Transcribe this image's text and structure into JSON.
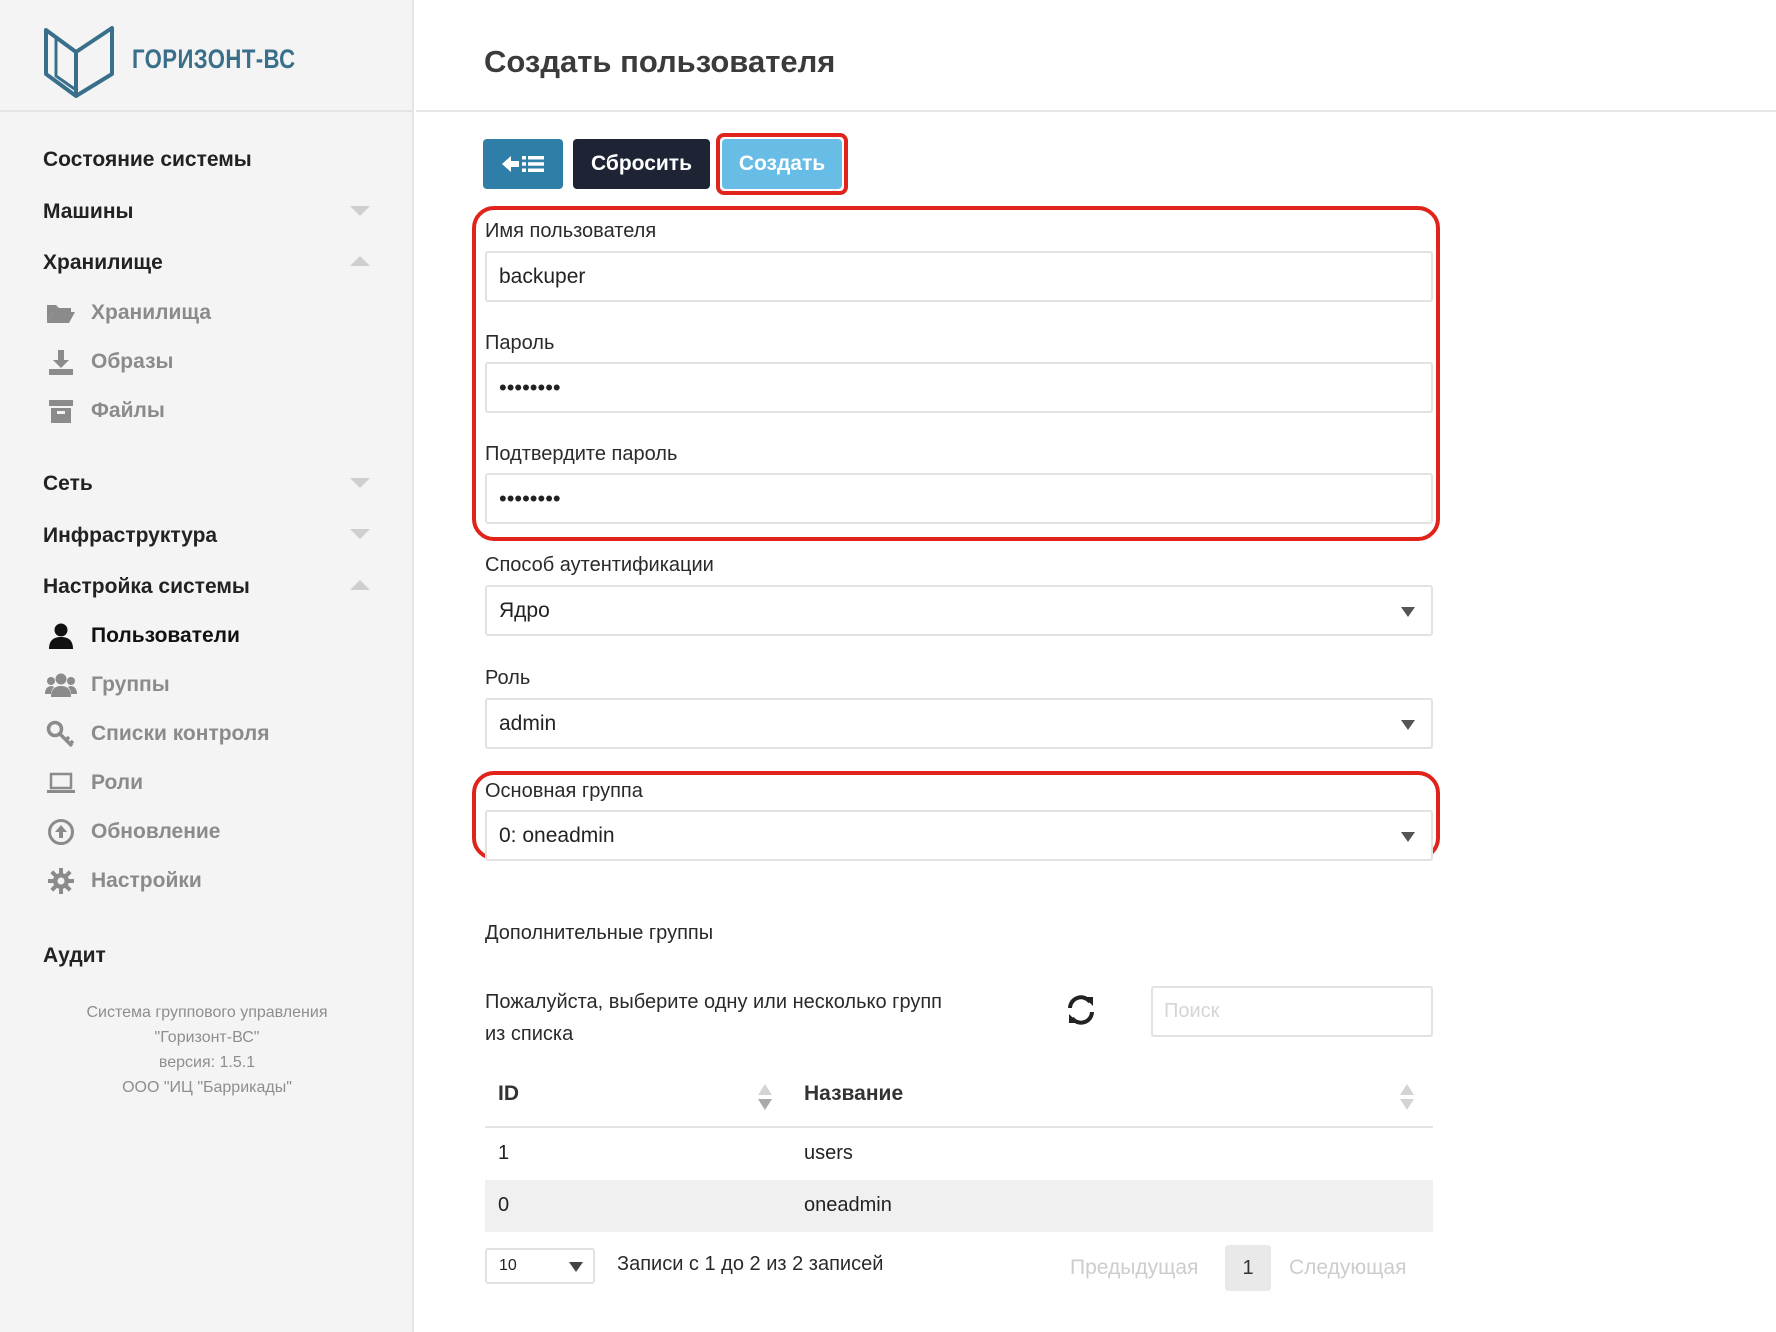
{
  "brand": {
    "name": "ГОРИЗОНТ-ВС"
  },
  "page": {
    "title": "Создать пользователя"
  },
  "toolbar": {
    "back_icon": "arrow-left-list-icon",
    "reset_label": "Сбросить",
    "create_label": "Создать"
  },
  "sidebar": {
    "sections": {
      "status": "Состояние системы",
      "machines": "Машины",
      "storage": "Хранилище",
      "network": "Сеть",
      "infra": "Инфраструктура",
      "settings": "Настройка системы",
      "audit": "Аудит"
    },
    "storage_items": [
      {
        "label": "Хранилища",
        "icon": "folder-open-icon"
      },
      {
        "label": "Образы",
        "icon": "download-icon"
      },
      {
        "label": "Файлы",
        "icon": "archive-icon"
      }
    ],
    "settings_items": [
      {
        "label": "Пользователи",
        "icon": "user-icon"
      },
      {
        "label": "Группы",
        "icon": "users-icon"
      },
      {
        "label": "Списки контроля",
        "icon": "key-icon"
      },
      {
        "label": "Роли",
        "icon": "laptop-icon"
      },
      {
        "label": "Обновление",
        "icon": "arrow-circle-up-icon"
      },
      {
        "label": "Настройки",
        "icon": "gear-icon"
      }
    ],
    "footer": {
      "line1": "Система группового управления",
      "line2": "\"Горизонт-ВС\"",
      "line3": "версия: 1.5.1",
      "line4": "ООО \"ИЦ \"Баррикады\""
    }
  },
  "form": {
    "username_label": "Имя пользователя",
    "username_value": "backuper",
    "password_label": "Пароль",
    "password_value": "••••••••",
    "confirm_label": "Подтвердите пароль",
    "confirm_value": "••••••••",
    "auth_label": "Способ аутентификации",
    "auth_value": "Ядро",
    "role_label": "Роль",
    "role_value": "admin",
    "group_label": "Основная группа",
    "group_value": "0: oneadmin"
  },
  "groups": {
    "title": "Дополнительные группы",
    "hint": "Пожалуйста, выберите одну или несколько групп из списка",
    "search_placeholder": "Поиск",
    "columns": [
      "ID",
      "Название"
    ],
    "rows": [
      {
        "id": "1",
        "name": "users"
      },
      {
        "id": "0",
        "name": "oneadmin"
      }
    ],
    "page_size": "10",
    "records_info": "Записи с 1 до 2 из 2 записей",
    "prev_label": "Предыдущая",
    "page": "1",
    "next_label": "Следующая"
  },
  "colors": {
    "highlight": "#e0241c",
    "create_button": "#67bde6",
    "back_button": "#2f7ea8",
    "reset_button": "#1f2434",
    "brand": "#3a6f8c"
  }
}
